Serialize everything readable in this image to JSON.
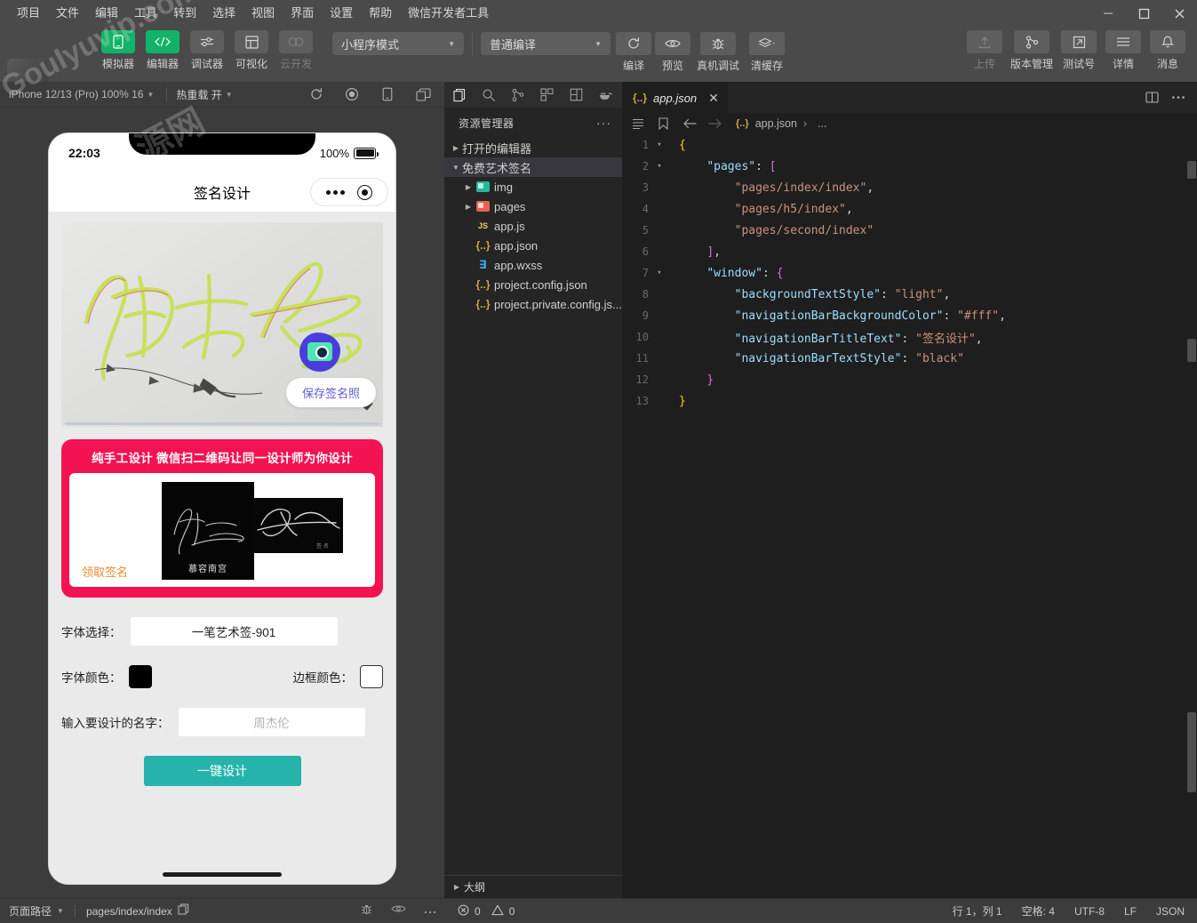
{
  "menubar": {
    "items": [
      "项目",
      "文件",
      "编辑",
      "工具",
      "转到",
      "选择",
      "视图",
      "界面",
      "设置",
      "帮助",
      "微信开发者工具"
    ],
    "window_controls": [
      "minimize",
      "maximize",
      "close"
    ]
  },
  "toolbar": {
    "mode_buttons": [
      {
        "label": "模拟器",
        "icon": "phone-icon",
        "active": true
      },
      {
        "label": "编辑器",
        "icon": "code-icon",
        "active": true
      },
      {
        "label": "调试器",
        "icon": "sliders-icon",
        "active": false
      },
      {
        "label": "可视化",
        "icon": "layout-icon",
        "active": false
      },
      {
        "label": "云开发",
        "icon": "cloud-icon",
        "active": false
      }
    ],
    "mode_select": "小程序模式",
    "compile_select": "普通编译",
    "action_buttons": [
      {
        "label": "编译",
        "icon": "refresh-icon"
      },
      {
        "label": "预览",
        "icon": "eye-icon"
      },
      {
        "label": "真机调试",
        "icon": "bug-icon"
      },
      {
        "label": "清缓存",
        "icon": "layers-icon"
      }
    ],
    "right_buttons": [
      {
        "label": "上传",
        "icon": "upload-icon",
        "dim": true
      },
      {
        "label": "版本管理",
        "icon": "branch-icon",
        "dim": false
      },
      {
        "label": "测试号",
        "icon": "external-link-icon",
        "dim": false
      },
      {
        "label": "详情",
        "icon": "menu-icon",
        "dim": false
      },
      {
        "label": "消息",
        "icon": "bell-icon",
        "dim": false
      }
    ]
  },
  "simulator": {
    "device": "iPhone 12/13 (Pro) 100% 16",
    "hot_reload": "热重载 开",
    "toolbar_icons": [
      "refresh-icon",
      "record-icon",
      "rotate-device-icon",
      "multi-window-icon"
    ],
    "phone": {
      "status_time": "22:03",
      "battery_percent": "100%",
      "nav_title": "签名设计",
      "save_button": "保存签名照",
      "promo_headline": "纯手工设计 微信扫二维码让同一设计师为你设计",
      "promo_card_name": "慕容南宫",
      "claim_label": "领取签名",
      "form": {
        "font_select_label": "字体选择：",
        "font_select_value": "一笔艺术签-901",
        "font_color_label": "字体颜色：",
        "font_color_value": "#000000",
        "border_color_label": "边框颜色：",
        "border_color_value": "#ffffff",
        "name_label": "输入要设计的名字：",
        "name_placeholder": "周杰伦",
        "submit_label": "一键设计"
      }
    }
  },
  "explorer": {
    "activity_icons": [
      "files-icon",
      "search-icon",
      "source-control-icon",
      "extensions-icon",
      "snippets-icon",
      "docker-icon"
    ],
    "title": "资源管理器",
    "more": "···",
    "sections": [
      {
        "label": "打开的编辑器",
        "expanded": false,
        "icon": "chevron-right-icon"
      },
      {
        "label": "免费艺术签名",
        "expanded": true,
        "icon": "chevron-down-icon"
      }
    ],
    "tree": [
      {
        "label": "img",
        "icon": "folder-img",
        "depth": 1,
        "expandable": true
      },
      {
        "label": "pages",
        "icon": "folder-pages",
        "depth": 1,
        "expandable": true
      },
      {
        "label": "app.js",
        "icon": "js-file",
        "depth": 1,
        "expandable": false
      },
      {
        "label": "app.json",
        "icon": "json-file",
        "depth": 1,
        "expandable": false
      },
      {
        "label": "app.wxss",
        "icon": "wxss-file",
        "depth": 1,
        "expandable": false
      },
      {
        "label": "project.config.json",
        "icon": "json-file",
        "depth": 1,
        "expandable": false
      },
      {
        "label": "project.private.config.js...",
        "icon": "json-file",
        "depth": 1,
        "expandable": false
      }
    ],
    "outline_label": "大纲"
  },
  "editor": {
    "tab": {
      "name": "app.json",
      "icon": "json-file",
      "close": "✕"
    },
    "tab_right_icons": [
      "split-editor-icon",
      "more-actions-icon"
    ],
    "breadcrumb_icons": [
      "outline-icon",
      "bookmark-icon",
      "back-arrow-icon",
      "forward-arrow-icon"
    ],
    "breadcrumb": {
      "file": "app.json",
      "sep": "›",
      "tail": "..."
    },
    "lines": [
      {
        "n": "1",
        "fold": "▾",
        "indent": 0,
        "tokens": [
          {
            "t": "{",
            "c": "br"
          }
        ]
      },
      {
        "n": "2",
        "fold": "▾",
        "indent": 1,
        "tokens": [
          {
            "t": "\"pages\"",
            "c": "k"
          },
          {
            "t": ": ",
            "c": "p"
          },
          {
            "t": "[",
            "c": "br2"
          }
        ]
      },
      {
        "n": "3",
        "fold": "",
        "indent": 2,
        "tokens": [
          {
            "t": "\"pages/index/index\"",
            "c": "s"
          },
          {
            "t": ",",
            "c": "p"
          }
        ]
      },
      {
        "n": "4",
        "fold": "",
        "indent": 2,
        "tokens": [
          {
            "t": "\"pages/h5/index\"",
            "c": "s"
          },
          {
            "t": ",",
            "c": "p"
          }
        ]
      },
      {
        "n": "5",
        "fold": "",
        "indent": 2,
        "tokens": [
          {
            "t": "\"pages/second/index\"",
            "c": "s"
          }
        ]
      },
      {
        "n": "6",
        "fold": "",
        "indent": 1,
        "tokens": [
          {
            "t": "]",
            "c": "br2"
          },
          {
            "t": ",",
            "c": "p"
          }
        ]
      },
      {
        "n": "7",
        "fold": "▾",
        "indent": 1,
        "tokens": [
          {
            "t": "\"window\"",
            "c": "k"
          },
          {
            "t": ": ",
            "c": "p"
          },
          {
            "t": "{",
            "c": "br2"
          }
        ]
      },
      {
        "n": "8",
        "fold": "",
        "indent": 2,
        "tokens": [
          {
            "t": "\"backgroundTextStyle\"",
            "c": "k"
          },
          {
            "t": ": ",
            "c": "p"
          },
          {
            "t": "\"light\"",
            "c": "s"
          },
          {
            "t": ",",
            "c": "p"
          }
        ]
      },
      {
        "n": "9",
        "fold": "",
        "indent": 2,
        "tokens": [
          {
            "t": "\"navigationBarBackgroundColor\"",
            "c": "k"
          },
          {
            "t": ": ",
            "c": "p"
          },
          {
            "t": "\"#fff\"",
            "c": "s"
          },
          {
            "t": ",",
            "c": "p"
          }
        ]
      },
      {
        "n": "10",
        "fold": "",
        "indent": 2,
        "tokens": [
          {
            "t": "\"navigationBarTitleText\"",
            "c": "k"
          },
          {
            "t": ": ",
            "c": "p"
          },
          {
            "t": "\"签名设计\"",
            "c": "s"
          },
          {
            "t": ",",
            "c": "p"
          }
        ]
      },
      {
        "n": "11",
        "fold": "",
        "indent": 2,
        "tokens": [
          {
            "t": "\"navigationBarTextStyle\"",
            "c": "k"
          },
          {
            "t": ": ",
            "c": "p"
          },
          {
            "t": "\"black\"",
            "c": "s"
          }
        ]
      },
      {
        "n": "12",
        "fold": "",
        "indent": 1,
        "tokens": [
          {
            "t": "}",
            "c": "br2"
          }
        ]
      },
      {
        "n": "13",
        "fold": "",
        "indent": 0,
        "tokens": [
          {
            "t": "}",
            "c": "br"
          }
        ]
      }
    ]
  },
  "statusbar": {
    "page_path_label": "页面路径",
    "page_path_value": "pages/index/index",
    "copy_icon": "copy-icon",
    "sim_icons": [
      "bug-icon",
      "eye-icon",
      "more-icon"
    ],
    "errors": "0",
    "warnings": "0",
    "cursor": "行 1，列 1",
    "spaces": "空格: 4",
    "encoding": "UTF-8",
    "eol": "LF",
    "language": "JSON"
  }
}
